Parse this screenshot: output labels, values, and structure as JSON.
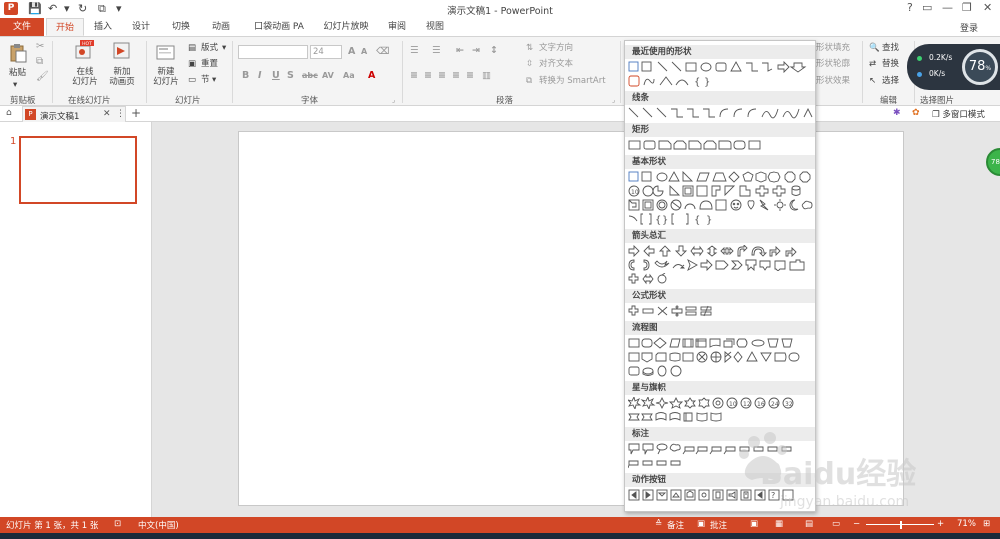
{
  "window": {
    "title": "演示文稿1 - PowerPoint",
    "login": "登录",
    "help_glyph": "?"
  },
  "ribbon_tabs": [
    "文件",
    "开始",
    "插入",
    "设计",
    "切换",
    "动画",
    "口袋动画 PA",
    "幻灯片放映",
    "审阅",
    "视图"
  ],
  "ribbon": {
    "clipboard": {
      "paste": "粘贴",
      "label": "剪贴板"
    },
    "online_slides": {
      "online": "在线\n幻灯片",
      "new_anim": "新加\n动画页",
      "label": "在线幻灯片",
      "hot": "HOT"
    },
    "slides": {
      "new_slide": "新建\n幻灯片",
      "layout": "版式",
      "reset": "重置",
      "section": "节",
      "label": "幻灯片"
    },
    "font": {
      "font_size": "24",
      "label": "字体",
      "bold": "B",
      "italic": "I",
      "underline": "U",
      "shadow": "S",
      "strike": "abc",
      "spacing": "AV",
      "case": "Aa",
      "color": "A"
    },
    "paragraph": {
      "text_direction": "文字方向",
      "align_text": "对齐文本",
      "smartart": "转换为 SmartArt",
      "label": "段落"
    },
    "drawing": {
      "shape_fill": "形状填充",
      "shape_outline": "形状轮廓",
      "shape_effects": "形状效果"
    },
    "editing": {
      "find": "查找",
      "replace": "替换",
      "select": "选择",
      "label": "编辑"
    },
    "select_image": {
      "label": "选择图片"
    }
  },
  "perf_widget": {
    "upload": "0.2K/s",
    "download": "0K/s",
    "percent": "78",
    "unit": "%"
  },
  "doc_tab": {
    "name": "演示文稿1",
    "close": "✕",
    "more": "⋮",
    "add": "+",
    "multiwindow": "多窗口模式"
  },
  "thumbnail": {
    "number": "1"
  },
  "shapes_panel": {
    "sections": [
      "最近使用的形状",
      "线条",
      "矩形",
      "基本形状",
      "箭头总汇",
      "公式形状",
      "流程图",
      "星与旗帜",
      "标注",
      "动作按钮"
    ]
  },
  "statusbar": {
    "slide_info": "幻灯片 第 1 张，共 1 张",
    "language": "中文(中国)",
    "notes": "备注",
    "comments": "批注",
    "zoom": "71%"
  },
  "green_ball": "78",
  "watermark": {
    "brand": "Baidu经验",
    "url": "jingyan.baidu.com"
  }
}
